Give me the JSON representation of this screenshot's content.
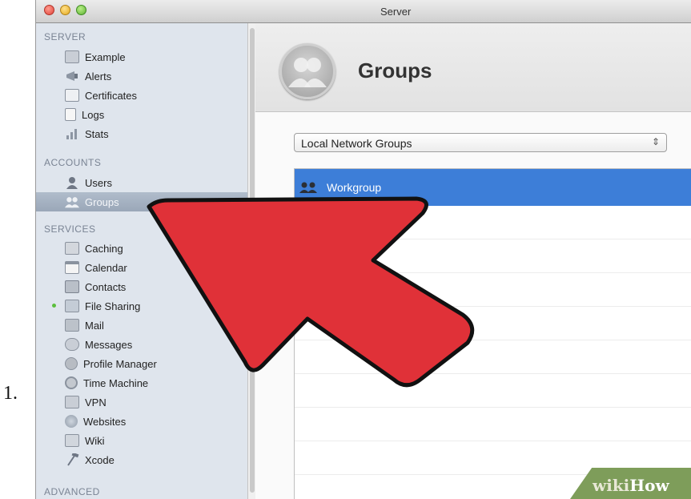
{
  "step_number": "1.",
  "window": {
    "title": "Server"
  },
  "sidebar": {
    "sections": {
      "server": "SERVER",
      "accounts": "ACCOUNTS",
      "services": "SERVICES",
      "advanced": "ADVANCED"
    },
    "server_items": [
      {
        "label": "Example",
        "icon": "server-icon"
      },
      {
        "label": "Alerts",
        "icon": "megaphone-icon"
      },
      {
        "label": "Certificates",
        "icon": "certificate-icon"
      },
      {
        "label": "Logs",
        "icon": "log-icon"
      },
      {
        "label": "Stats",
        "icon": "bar-chart-icon"
      }
    ],
    "account_items": [
      {
        "label": "Users",
        "icon": "user-icon"
      },
      {
        "label": "Groups",
        "icon": "group-icon",
        "selected": true
      }
    ],
    "service_items": [
      {
        "label": "Caching",
        "icon": "caching-icon"
      },
      {
        "label": "Calendar",
        "icon": "calendar-icon"
      },
      {
        "label": "Contacts",
        "icon": "contacts-icon"
      },
      {
        "label": "File Sharing",
        "icon": "folder-icon",
        "active": true
      },
      {
        "label": "Mail",
        "icon": "mail-icon"
      },
      {
        "label": "Messages",
        "icon": "messages-icon"
      },
      {
        "label": "Profile Manager",
        "icon": "gear-icon"
      },
      {
        "label": "Time Machine",
        "icon": "time-machine-icon"
      },
      {
        "label": "VPN",
        "icon": "vpn-icon"
      },
      {
        "label": "Websites",
        "icon": "globe-icon"
      },
      {
        "label": "Wiki",
        "icon": "wiki-icon"
      },
      {
        "label": "Xcode",
        "icon": "hammer-icon"
      }
    ]
  },
  "main": {
    "title": "Groups",
    "group_source": "Local Network Groups",
    "groups": [
      "Workgroup"
    ]
  },
  "watermark": {
    "part1": "wiki",
    "part2": "How"
  },
  "colors": {
    "selection_blue": "#3d7ed8",
    "arrow_red": "#e03138",
    "sidebar_bg": "#dfe5ed"
  }
}
